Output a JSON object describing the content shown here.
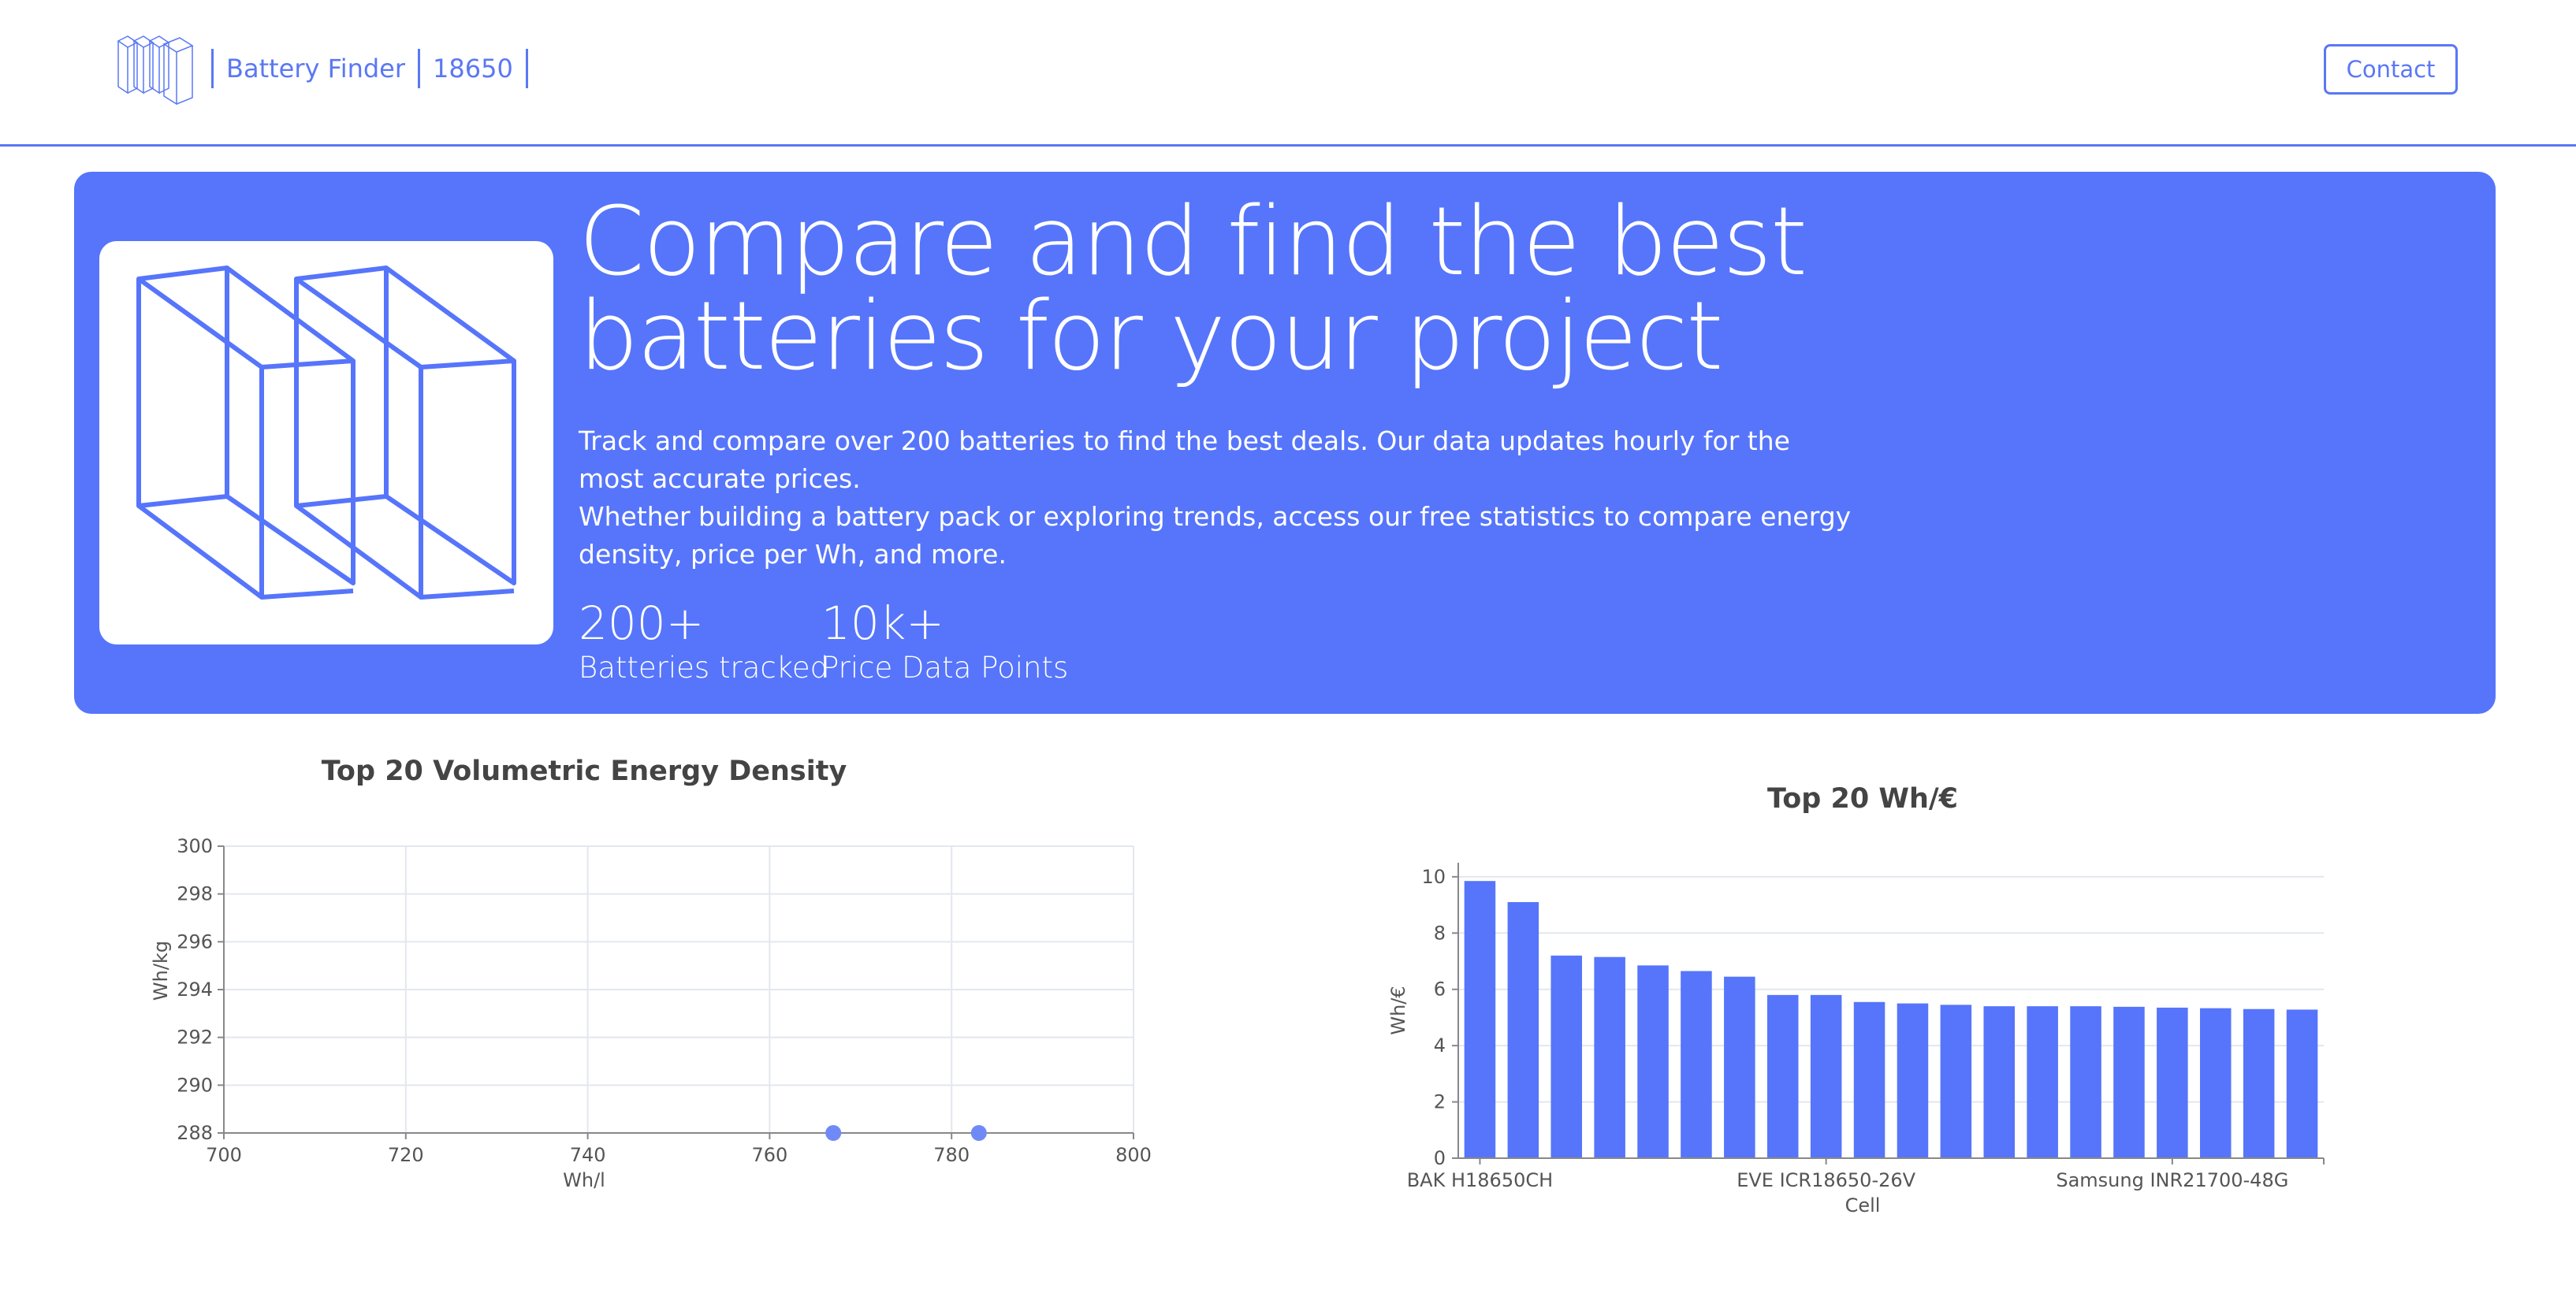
{
  "header": {
    "brand_name": "Battery Finder",
    "brand_format": "18650",
    "contact_label": "Contact"
  },
  "hero": {
    "title_line1": "Compare and find the best",
    "title_line2": "batteries for your project",
    "desc_line1": "Track and compare over 200 batteries to find the best deals. Our data updates hourly for the most accurate prices.",
    "desc_line2": "Whether building a battery pack or exploring trends, access our free statistics to compare energy density, price per Wh, and more.",
    "stats": [
      {
        "value": "200+",
        "label": "Batteries tracked"
      },
      {
        "value": "10k+",
        "label": "Price Data Points"
      }
    ]
  },
  "colors": {
    "accent": "#5675fb",
    "header_accent": "#5a78f4"
  },
  "chart_data": [
    {
      "type": "scatter",
      "title": "Top 20 Volumetric Energy Density",
      "xlabel": "Wh/l",
      "ylabel": "Wh/kg",
      "xlim": [
        700,
        800
      ],
      "ylim": [
        288,
        300
      ],
      "xticks": [
        700,
        720,
        740,
        760,
        780,
        800
      ],
      "yticks": [
        288,
        290,
        292,
        294,
        296,
        298,
        300
      ],
      "points": [
        {
          "x": 767,
          "y": 288
        },
        {
          "x": 783,
          "y": 288
        }
      ]
    },
    {
      "type": "bar",
      "title": "Top 20 Wh/€",
      "xlabel": "Cell",
      "ylabel": "Wh/€",
      "ylim": [
        0,
        10.5
      ],
      "yticks": [
        0,
        2,
        4,
        6,
        8,
        10
      ],
      "tick_labels": [
        "BAK H18650CH",
        "EVE ICR18650-26V",
        "Samsung INR21700-48G"
      ],
      "tick_label_indices": [
        0,
        8,
        16
      ],
      "values": [
        9.85,
        9.1,
        7.2,
        7.15,
        6.85,
        6.65,
        6.45,
        5.8,
        5.8,
        5.55,
        5.5,
        5.45,
        5.4,
        5.4,
        5.4,
        5.38,
        5.35,
        5.33,
        5.3,
        5.28
      ]
    }
  ]
}
